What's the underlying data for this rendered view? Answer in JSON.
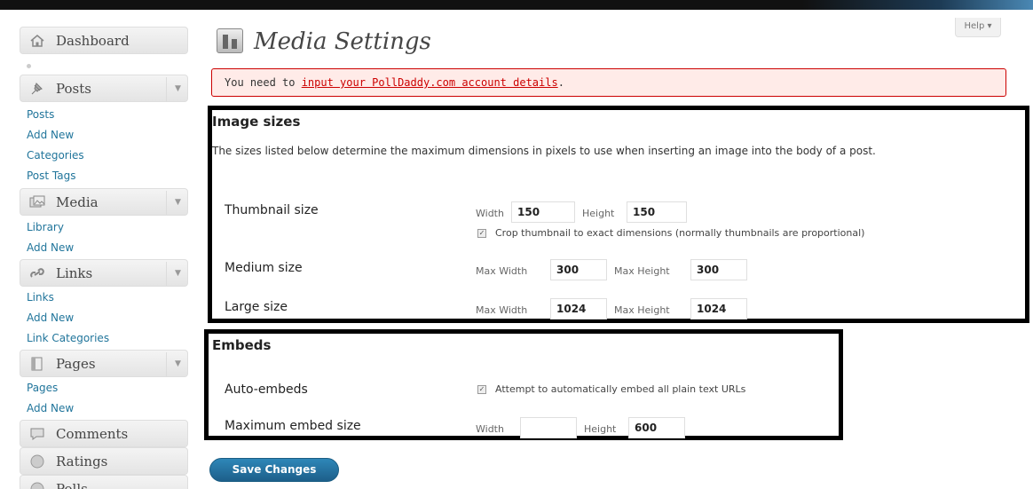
{
  "sidebar": {
    "dashboard": "Dashboard",
    "posts": {
      "label": "Posts",
      "items": [
        "Posts",
        "Add New",
        "Categories",
        "Post Tags"
      ]
    },
    "media": {
      "label": "Media",
      "items": [
        "Library",
        "Add New"
      ]
    },
    "links": {
      "label": "Links",
      "items": [
        "Links",
        "Add New",
        "Link Categories"
      ]
    },
    "pages": {
      "label": "Pages",
      "items": [
        "Pages",
        "Add New"
      ]
    },
    "comments": "Comments",
    "ratings": "Ratings",
    "polls": "Polls"
  },
  "header": {
    "title": "Media Settings",
    "help": "Help ▾"
  },
  "notice": {
    "prefix": "You need to ",
    "link": "input your PollDaddy.com account details",
    "suffix": "."
  },
  "image_sizes": {
    "title": "Image sizes",
    "description": "The sizes listed below determine the maximum dimensions in pixels to use when inserting an image into the body of a post.",
    "thumbnail": {
      "label": "Thumbnail size",
      "width_label": "Width",
      "width": "150",
      "height_label": "Height",
      "height": "150",
      "crop_label": "Crop thumbnail to exact dimensions (normally thumbnails are proportional)"
    },
    "medium": {
      "label": "Medium size",
      "width_label": "Max Width",
      "width": "300",
      "height_label": "Max Height",
      "height": "300"
    },
    "large": {
      "label": "Large size",
      "width_label": "Max Width",
      "width": "1024",
      "height_label": "Max Height",
      "height": "1024"
    }
  },
  "embeds": {
    "title": "Embeds",
    "auto": {
      "label": "Auto-embeds",
      "checkbox_label": "Attempt to automatically embed all plain text URLs"
    },
    "max": {
      "label": "Maximum embed size",
      "width_label": "Width",
      "width": "",
      "height_label": "Height",
      "height": "600"
    }
  },
  "save_label": "Save Changes",
  "colors": {
    "link": "#21759b",
    "primary_button": "#21759b",
    "notice_bg": "#ffebe8",
    "notice_border": "#cc0000"
  }
}
